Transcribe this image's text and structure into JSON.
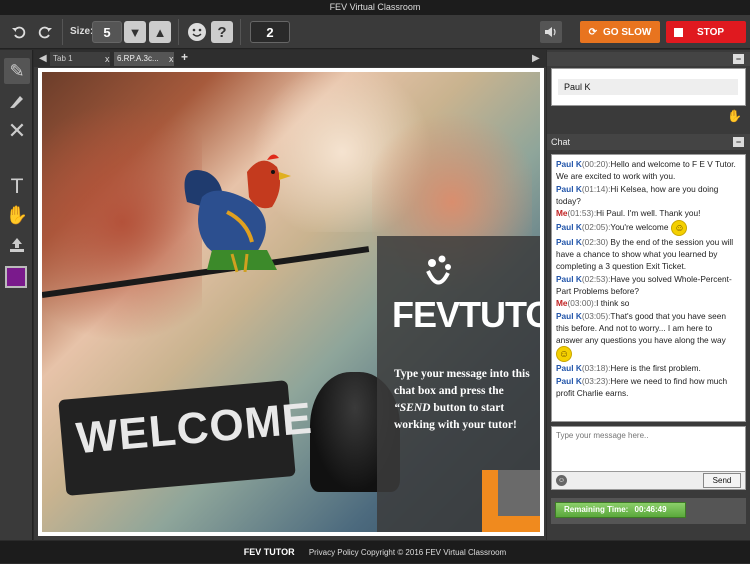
{
  "window": {
    "title": "FEV Virtual Classroom"
  },
  "toolbar": {
    "size_label": "Size:",
    "size_value": "5",
    "page_value": "2",
    "go_slow_label": "GO SLOW",
    "stop_label": "STOP",
    "icons": [
      "undo-icon",
      "redo-icon",
      "arrow-down-icon",
      "arrow-up-icon",
      "smiley-icon",
      "help-icon",
      "speaker-icon",
      "refresh-icon"
    ]
  },
  "tools": [
    "pencil-icon",
    "eraser-icon",
    "clear-icon",
    "text-icon",
    "hand-icon",
    "upload-icon",
    "color-swatch"
  ],
  "tabs": [
    {
      "label": "Tab 1"
    },
    {
      "label": "6.RP.A.3c..."
    }
  ],
  "canvas": {
    "sign_text": "WELCOME",
    "logo_text": "FEVTUTOR",
    "overlay_message_1": "Type your message into this chat box and press the ",
    "overlay_message_send": "“SEND",
    "overlay_message_2": "button to start working with your tutor!"
  },
  "participants": {
    "user": "Paul K"
  },
  "chat": {
    "label": "Chat",
    "messages": [
      {
        "who": "Paul K",
        "me": false,
        "time": "(00:20):",
        "text": "Hello and welcome to F E V Tutor. We are excited to work with you."
      },
      {
        "who": "Paul K",
        "me": false,
        "time": "(01:14):",
        "text": "Hi Kelsea, how are you doing today?"
      },
      {
        "who": "Me",
        "me": true,
        "time": "(01:53):",
        "text": "Hi Paul. I'm well. Thank you!"
      },
      {
        "who": "Paul K",
        "me": false,
        "time": "(02:05):",
        "text": "You're welcome"
      },
      {
        "who": "Paul K",
        "me": false,
        "time": "(02:30)",
        "text": " By the end of the session you will have a chance to show what you learned by completing a 3 question Exit Ticket."
      },
      {
        "who": "Paul K",
        "me": false,
        "time": "(02:53):",
        "text": "Have you solved Whole-Percent-Part Problems before?"
      },
      {
        "who": "Me",
        "me": true,
        "time": "(03:00):",
        "text": "I think so"
      },
      {
        "who": "Paul K",
        "me": false,
        "time": "(03:05):",
        "text": "That's good that you have seen this before. And not to worry... I am here to answer any questions you have along the way"
      },
      {
        "who": "Paul K",
        "me": false,
        "time": "(03:18):",
        "text": "Here is the first problem."
      },
      {
        "who": "Paul K",
        "me": false,
        "time": "(03:23):",
        "text": "Here we need to find how much profit Charlie earns."
      }
    ],
    "input_placeholder": "Type your message here..",
    "send_label": "Send"
  },
  "timer": {
    "label": "Remaining Time:",
    "value": "00:46:49",
    "fill_fraction": 0.7
  },
  "footer": {
    "brand": "FEV TUTOR",
    "text": "Privacy Policy Copyright © 2016 FEV Virtual Classroom"
  }
}
